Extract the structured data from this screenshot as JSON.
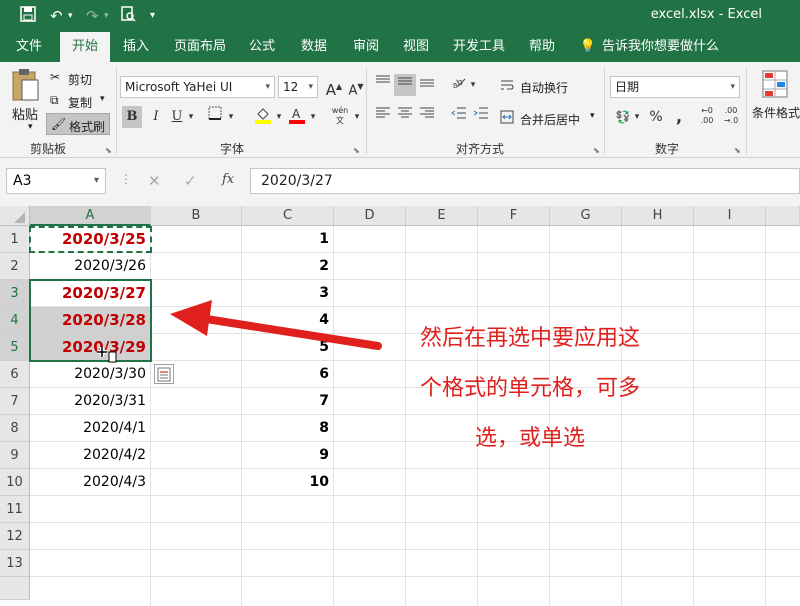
{
  "titlebar": {
    "title": "excel.xlsx  -  Excel"
  },
  "tabs": [
    "文件",
    "开始",
    "插入",
    "页面布局",
    "公式",
    "数据",
    "审阅",
    "视图",
    "开发工具",
    "帮助"
  ],
  "tell_me": "告诉我你想要做什么",
  "ribbon": {
    "clipboard": {
      "paste": "粘贴",
      "cut": "剪切",
      "copy": "复制",
      "format_painter": "格式刷",
      "label": "剪贴板"
    },
    "font": {
      "name": "Microsoft YaHei UI",
      "size": "12",
      "label": "字体",
      "bold": "B",
      "italic": "I",
      "underline": "U",
      "phonetic": "wén"
    },
    "alignment": {
      "wrap": "自动换行",
      "merge": "合并后居中",
      "label": "对齐方式"
    },
    "number": {
      "format": "日期",
      "label": "数字"
    },
    "styles": {
      "conditional": "条件格式"
    }
  },
  "formula_bar": {
    "name_box": "A3",
    "fx": "fx",
    "value": "2020/3/27"
  },
  "columns": [
    "A",
    "B",
    "C",
    "D",
    "E",
    "F",
    "G",
    "H",
    "I"
  ],
  "rows": [
    "1",
    "2",
    "3",
    "4",
    "5",
    "6",
    "7",
    "8",
    "9",
    "10",
    "11",
    "12",
    "13"
  ],
  "col_a": [
    "2020/3/25",
    "2020/3/26",
    "2020/3/27",
    "2020/3/28",
    "2020/3/29",
    "2020/3/30",
    "2020/3/31",
    "2020/4/1",
    "2020/4/2",
    "2020/4/3"
  ],
  "col_c": [
    "1",
    "2",
    "3",
    "4",
    "5",
    "6",
    "7",
    "8",
    "9",
    "10"
  ],
  "annotation": [
    "然后在再选中要应用这",
    "个格式的单元格，可多",
    "选，或单选"
  ],
  "colors": {
    "accent": "#217346",
    "highlight_text": "#c00000",
    "annotation": "#e0201c"
  }
}
